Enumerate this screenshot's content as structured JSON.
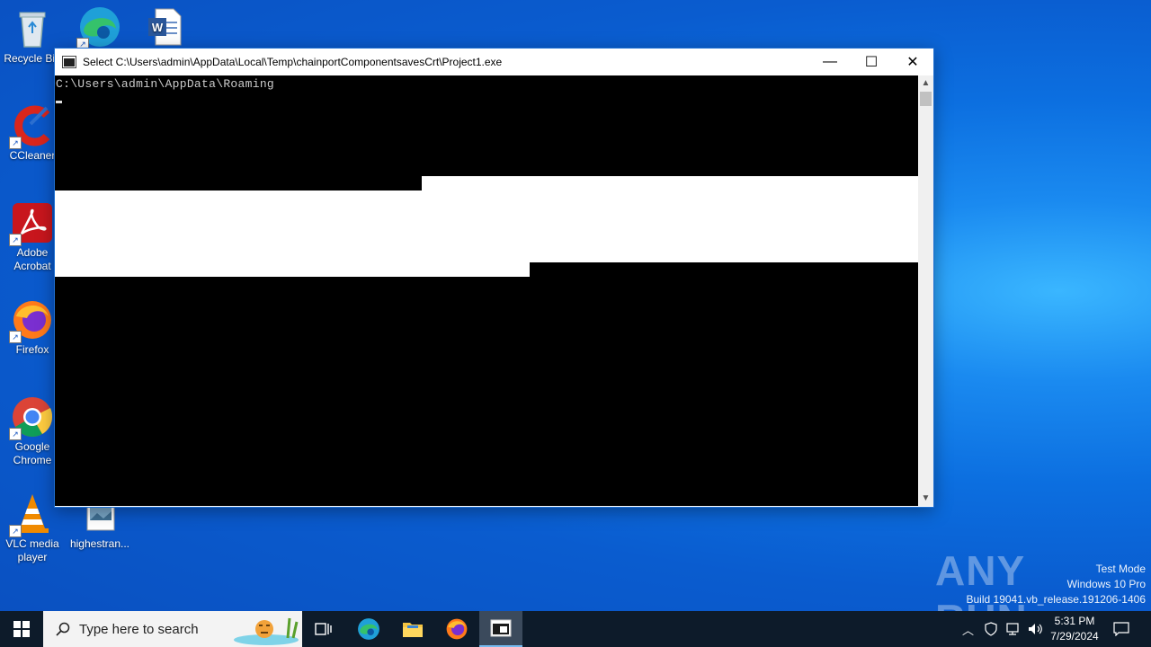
{
  "desktop": {
    "icons": [
      {
        "label": "Recycle Bin"
      },
      {
        "label": ""
      },
      {
        "label": ""
      },
      {
        "label": "CCleaner"
      },
      {
        "label": "Adobe Acrobat"
      },
      {
        "label": "Firefox"
      },
      {
        "label": "Google Chrome"
      },
      {
        "label": "VLC media player"
      },
      {
        "label": "highestran..."
      }
    ]
  },
  "window": {
    "title": "Select C:\\Users\\admin\\AppData\\Local\\Temp\\chainportComponentsavesCrt\\Project1.exe",
    "console_line": "C:\\Users\\admin\\AppData\\Roaming",
    "buttons": {
      "minimize": "—",
      "maximize": "☐",
      "close": "✕"
    }
  },
  "watermark": {
    "brand": "ANY RUN",
    "mode": "Test Mode",
    "os": "Windows 10 Pro",
    "build": "Build 19041.vb_release.191206-1406"
  },
  "taskbar": {
    "search_placeholder": "Type here to search",
    "time": "5:31 PM",
    "date": "7/29/2024"
  },
  "colors": {
    "accent": "#1f6fd1",
    "taskbar": "#0d1b2a",
    "console_bg": "#000000"
  }
}
